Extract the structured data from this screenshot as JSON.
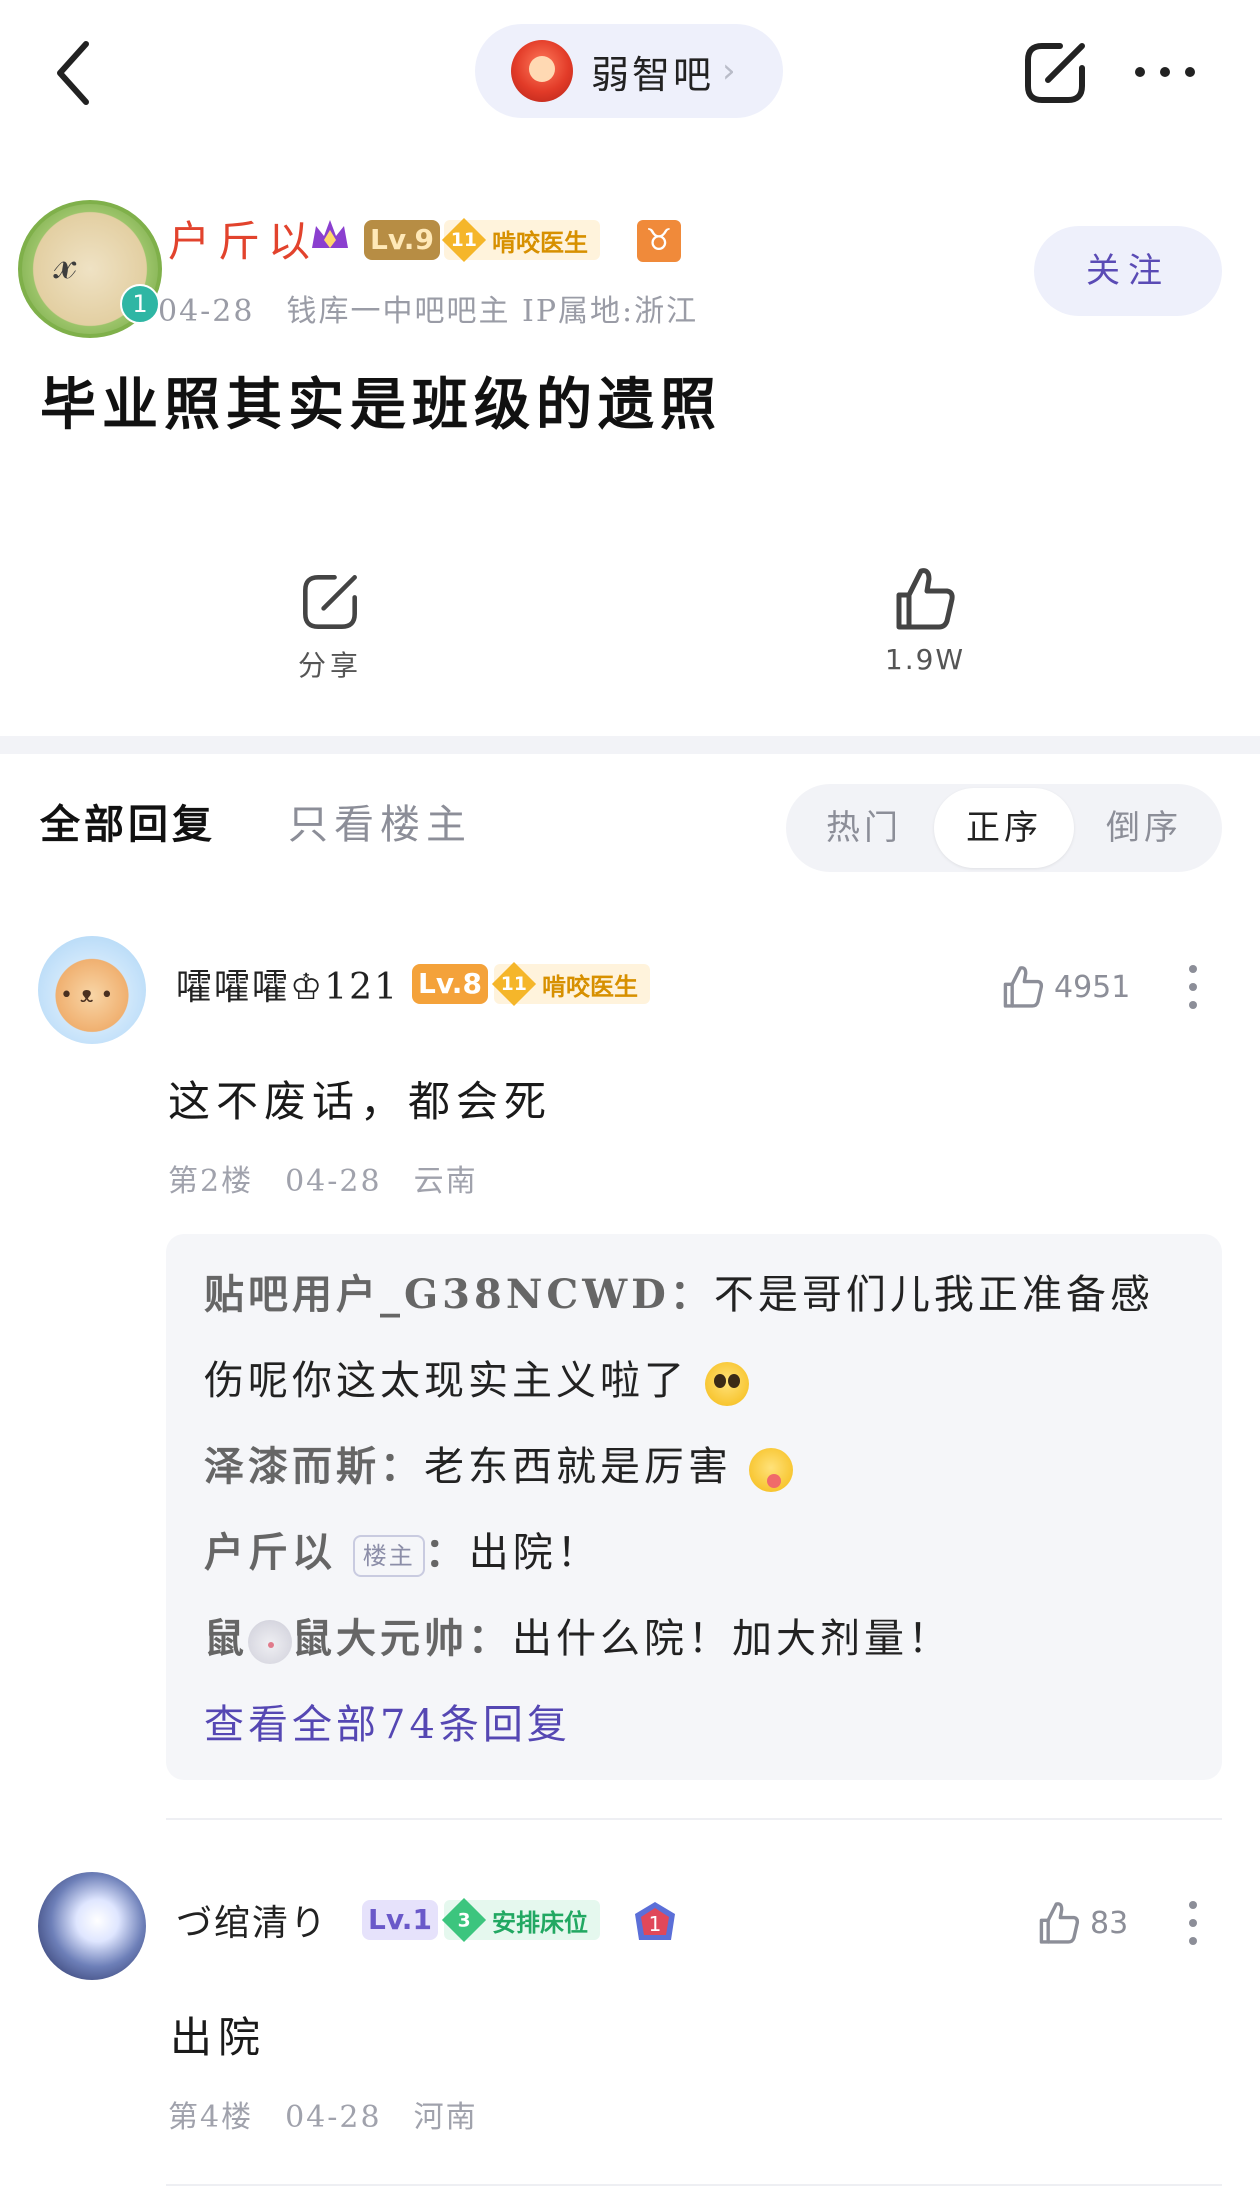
{
  "header": {
    "forum_name": "弱智吧",
    "forum_chevron": "›"
  },
  "post": {
    "author": {
      "name": "户斤以",
      "level": "Lv.9",
      "badge_num": "11",
      "badge_title": "啃咬医生",
      "zodiac_symbol": "♉",
      "meta": "04-28　钱库一中吧吧主 IP属地:浙江",
      "avatar_badge": "1"
    },
    "follow_label": "关注",
    "title": "毕业照其实是班级的遗照",
    "share_label": "分享",
    "like_count": "1.9W"
  },
  "tabs": {
    "all": "全部回复",
    "op_only": "只看楼主"
  },
  "sort": {
    "hot": "热门",
    "asc": "正序",
    "desc": "倒序",
    "selected": "正序"
  },
  "comments": [
    {
      "name": "嚯嚯嚯♔121",
      "level": "Lv.8",
      "badge_num": "11",
      "badge_title": "啃咬医生",
      "likes": "4951",
      "text": "这不废话，都会死",
      "meta": "第2楼　04-28　云南",
      "replies": [
        {
          "name": "贴吧用户_G38NCWD",
          "sep": "：",
          "text_line1": "不是哥们儿我正准备感",
          "text_line2": "伤呢你这太现实主义啦了"
        },
        {
          "name": "泽漆而斯",
          "sep": "：",
          "text": "老东西就是厉害"
        },
        {
          "name": "户斤以",
          "tag": "楼主",
          "sep": "：",
          "text": "出院！"
        },
        {
          "name_part1": "鼠",
          "name_part2": "鼠大元帅",
          "sep": "：",
          "text": "出什么院！加大剂量！"
        }
      ],
      "view_all": "查看全部74条回复"
    },
    {
      "name": "づ绾清り",
      "level": "Lv.1",
      "badge_num": "3",
      "badge_title": "安排床位",
      "hex_badge": "1",
      "likes": "83",
      "text": "出院",
      "meta": "第4楼　04-28　河南"
    }
  ],
  "colors": {
    "accent": "#5547b3",
    "author_name": "#e2432d",
    "pill_bg": "#eef0fb",
    "reply_bg": "#f5f6f9"
  },
  "icons": [
    "back-icon",
    "share-icon",
    "more-icon",
    "crown-icon",
    "zodiac-icon",
    "thumbs-up-icon",
    "hex-badge-icon"
  ]
}
